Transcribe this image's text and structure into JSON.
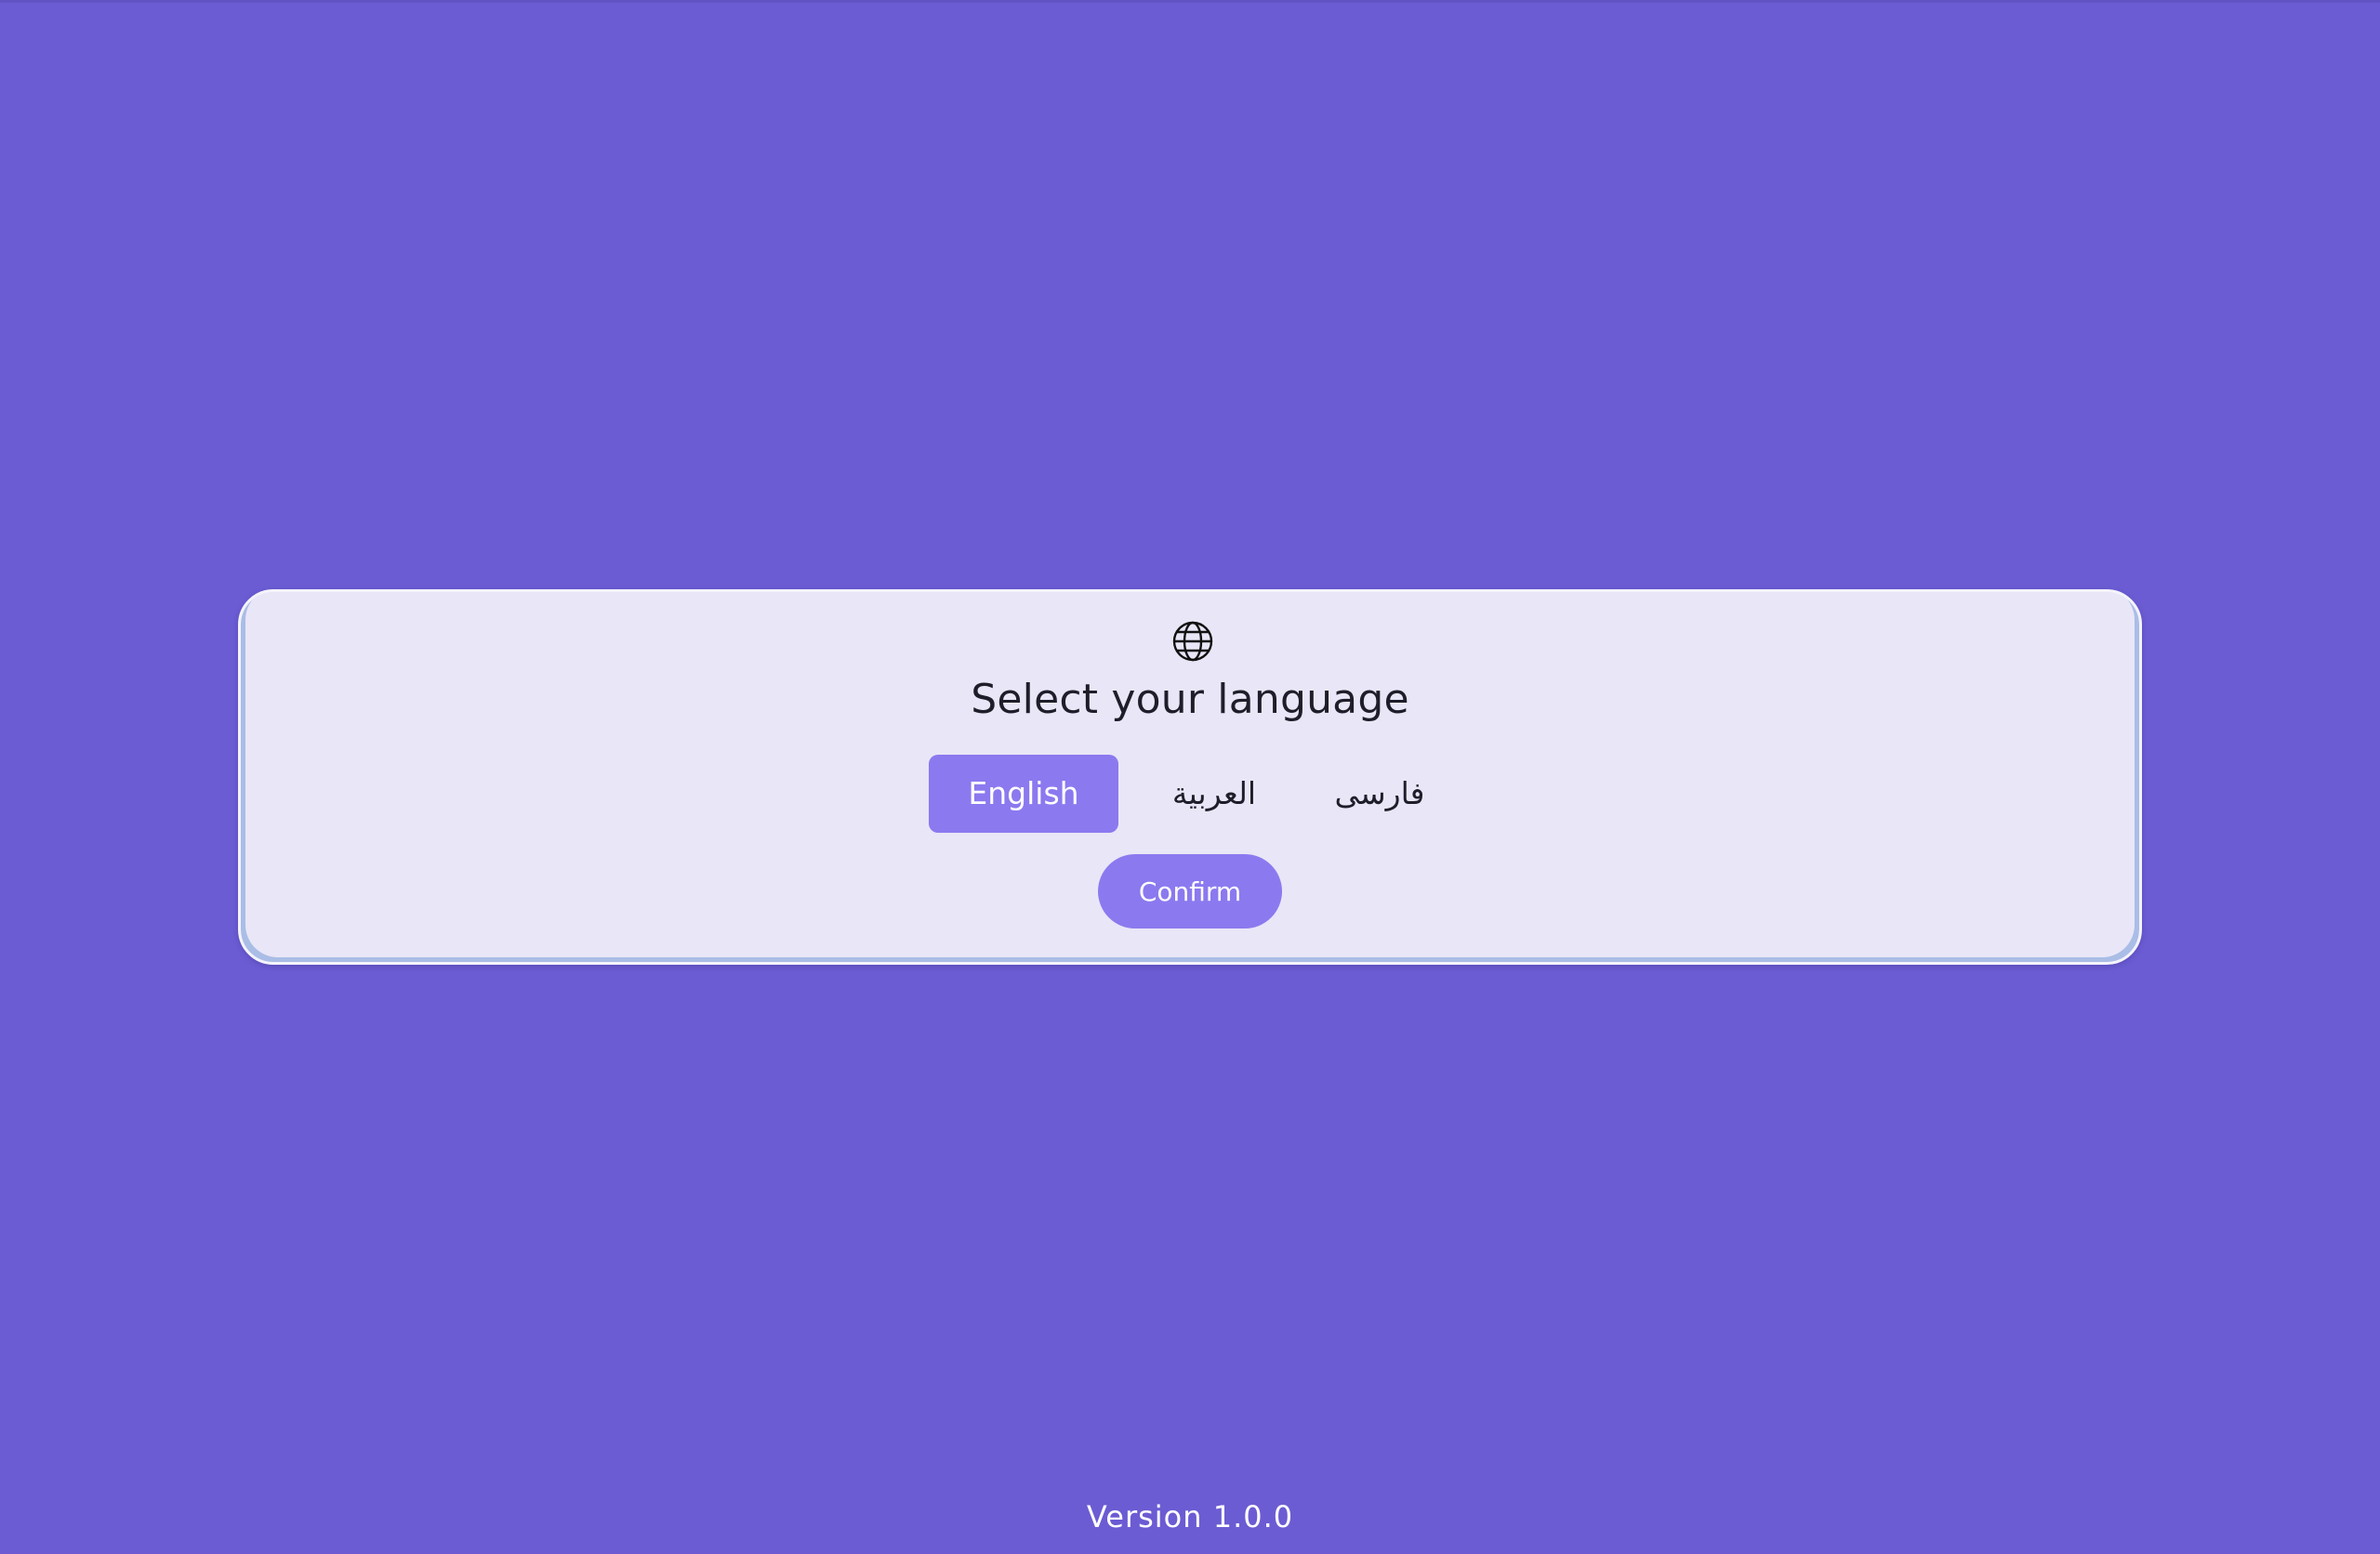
{
  "language_dialog": {
    "icon": "globe-icon",
    "title": "Select your language",
    "options": [
      {
        "label": "English",
        "selected": true
      },
      {
        "label": "العربية",
        "selected": false
      },
      {
        "label": "فارسی",
        "selected": false
      }
    ],
    "confirm_label": "Confirm"
  },
  "footer": {
    "version": "Version 1.0.0"
  },
  "colors": {
    "background": "#6b5cd3",
    "card": "#e9e6f7",
    "accent": "#8b79ef",
    "text": "#1e1e2a"
  }
}
